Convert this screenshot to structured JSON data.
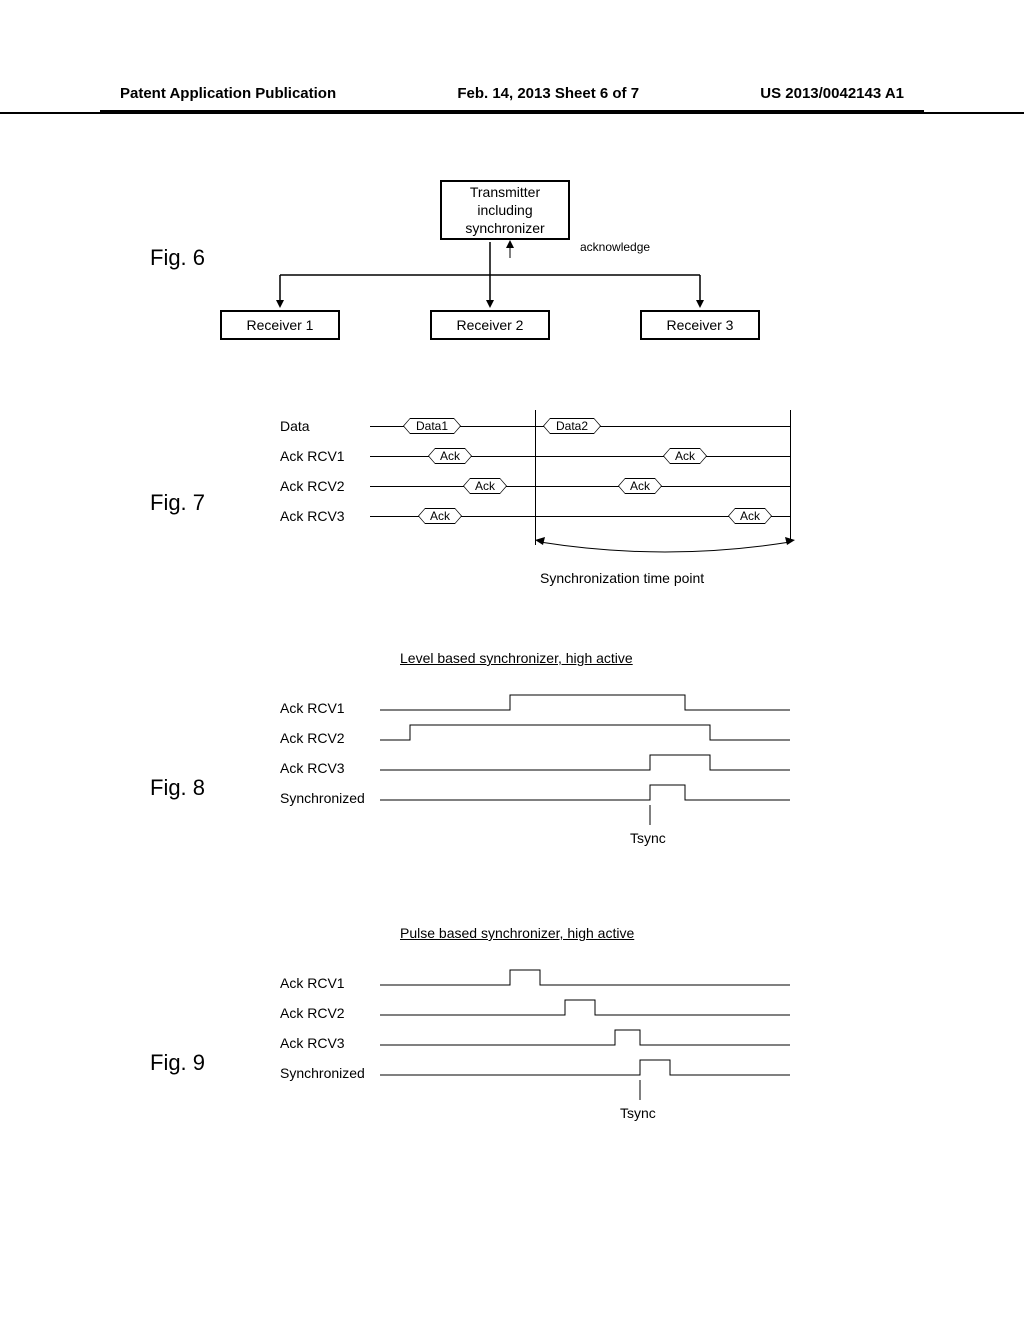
{
  "header": {
    "left": "Patent Application Publication",
    "center": "Feb. 14, 2013  Sheet 6 of 7",
    "right": "US 2013/0042143 A1"
  },
  "fig6": {
    "label": "Fig. 6",
    "transmitter": "Transmitter\nincluding\nsynchronizer",
    "acknowledge": "acknowledge",
    "receiver1": "Receiver 1",
    "receiver2": "Receiver 2",
    "receiver3": "Receiver 3"
  },
  "fig7": {
    "label": "Fig. 7",
    "data_label": "Data",
    "ack1_label": "Ack RCV1",
    "ack2_label": "Ack RCV2",
    "ack3_label": "Ack RCV3",
    "data1": "Data1",
    "data2": "Data2",
    "ack": "Ack",
    "sync_caption": "Synchronization time point"
  },
  "fig8": {
    "label": "Fig. 8",
    "title": "Level based synchronizer, high active",
    "ack1_label": "Ack RCV1",
    "ack2_label": "Ack RCV2",
    "ack3_label": "Ack RCV3",
    "sync_label": "Synchronized",
    "tsync": "Tsync"
  },
  "fig9": {
    "label": "Fig. 9",
    "title": "Pulse based synchronizer, high active",
    "ack1_label": "Ack RCV1",
    "ack2_label": "Ack RCV2",
    "ack3_label": "Ack RCV3",
    "sync_label": "Synchronized",
    "tsync": "Tsync"
  }
}
